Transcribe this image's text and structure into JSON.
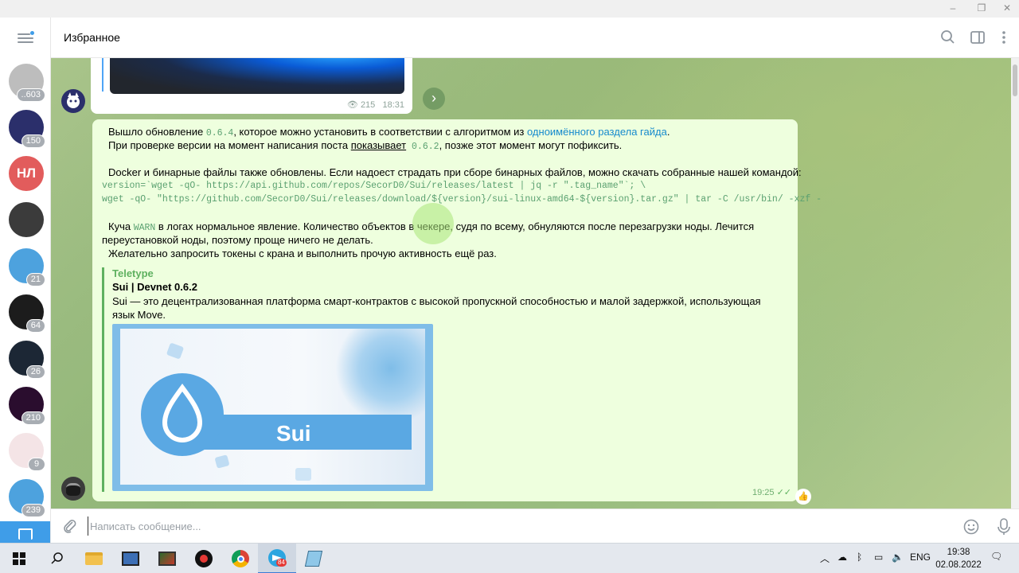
{
  "window": {
    "controls": [
      "–",
      "❐",
      "✕"
    ]
  },
  "sidebar": {
    "chats": [
      {
        "name": "chat-1",
        "initials": "",
        "badge": "..603",
        "color": "#bdbdbd"
      },
      {
        "name": "chat-2",
        "initials": "",
        "badge": "150",
        "color": "#2b2f6b"
      },
      {
        "name": "chat-3",
        "initials": "НЛ",
        "badge": "",
        "color": "#e25c5c"
      },
      {
        "name": "chat-4",
        "initials": "",
        "badge": "",
        "color": "#3b3b3b"
      },
      {
        "name": "chat-5",
        "initials": "",
        "badge": "21",
        "color": "#4da2de"
      },
      {
        "name": "chat-6",
        "initials": "",
        "badge": "64",
        "color": "#1c1c1c"
      },
      {
        "name": "chat-7",
        "initials": "",
        "badge": "26",
        "color": "#1c2735"
      },
      {
        "name": "chat-8",
        "initials": "",
        "badge": "210",
        "color": "#2a0d2e"
      },
      {
        "name": "chat-9",
        "initials": "",
        "badge": "9",
        "color": "#f4e4e6"
      },
      {
        "name": "chat-10",
        "initials": "",
        "badge": "239",
        "color": "#4da2de"
      }
    ]
  },
  "header": {
    "title": "Избранное"
  },
  "messages": {
    "first": {
      "views": "215",
      "time": "18:31"
    },
    "second": {
      "p1_a": "Вышло обновление ",
      "p1_code": "0.6.4",
      "p1_b": ", которое можно установить в соответствии с алгоритмом из ",
      "p1_link": "одноимённого раздела гайда",
      "p1_c": ".",
      "p2_a": "При проверке версии на момент написания поста ",
      "p2_u": "показывает",
      "p2_code": " 0.6.2",
      "p2_b": ", позже этот момент могут пофиксить.",
      "p3": "Docker и бинарные файлы также обновлены. Если надоест страдать при сборе бинарных файлов, можно скачать собранные нашей командой:",
      "code1": "version=`wget -qO- https://api.github.com/repos/SecorD0/Sui/releases/latest | jq -r \".tag_name\"`; \\",
      "code2": "wget -qO- \"https://github.com/SecorD0/Sui/releases/download/${version}/sui-linux-amd64-${version}.tar.gz\" | tar -C /usr/bin/ -xzf -",
      "p4_a": "Куча ",
      "p4_code": "WARN",
      "p4_b": " в логах нормальное явление. Количество объектов в чекере, судя по всему, обнуляются после перезагрузки ноды. Лечится",
      "p5": "переустановкой ноды, поэтому проще ничего не делать.",
      "p6": "Желательно запросить токены с крана и выполнить прочую активность ещё раз.",
      "preview": {
        "site": "Teletype",
        "title": "Sui | Devnet 0.6.2",
        "desc": "Sui — это децентрализованная платформа смарт-контрактов с высокой пропускной способностью и малой задержкой, использующая язык Move.",
        "image_text": "Sui"
      },
      "time": "19:25",
      "reaction": "👍"
    }
  },
  "composer": {
    "placeholder": "Написать сообщение..."
  },
  "taskbar": {
    "language": "ENG",
    "time": "19:38",
    "date": "02.08.2022",
    "telegram_badge": "84"
  },
  "colors": {
    "accent": "#3f9de8",
    "bubble_out": "#eeffde",
    "link": "#168acd",
    "code": "#5aa070",
    "teletype": "#5fb160"
  }
}
